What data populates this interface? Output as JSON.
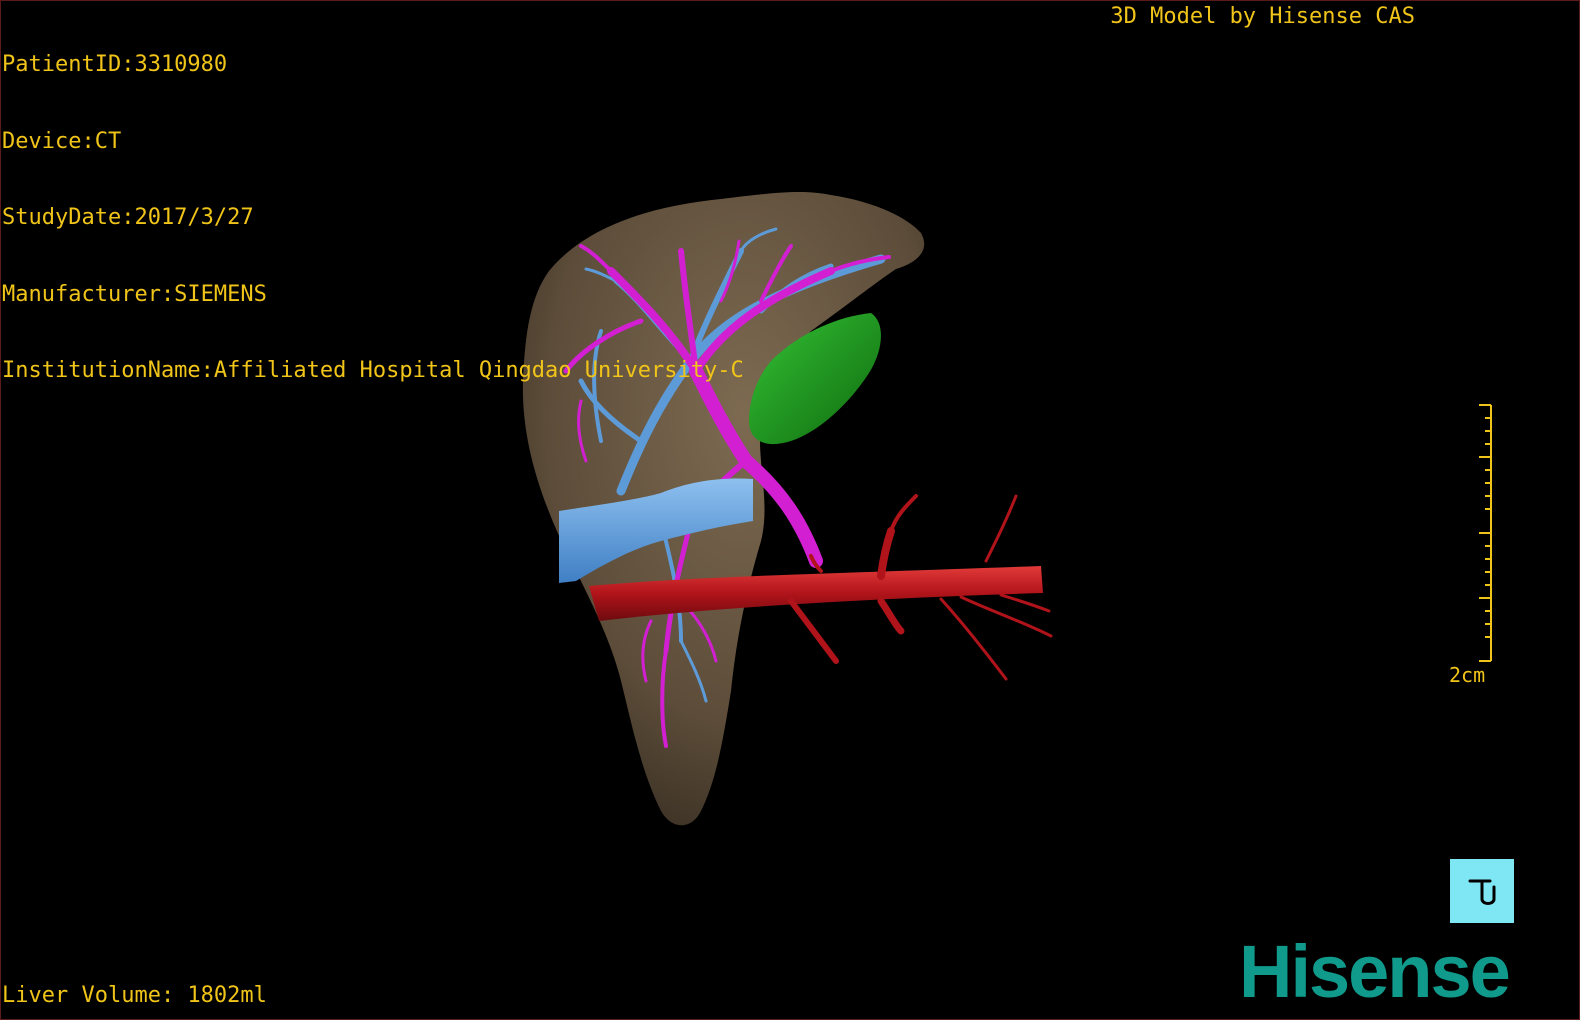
{
  "info": {
    "patient_id": "PatientID:3310980",
    "device": "Device:CT",
    "study_date": "StudyDate:2017/3/27",
    "manufacturer": "Manufacturer:SIEMENS",
    "institution": "InstitutionName:Affiliated Hospital Qingdao University-C"
  },
  "credit": "3D Model by Hisense CAS",
  "volume": "Liver Volume: 1802ml",
  "scale_label": "2cm",
  "brand": "Hisense",
  "orientation_icon": "posterior-view-icon",
  "colors": {
    "overlay_text": "#f0c419",
    "liver": "#6b5a44",
    "portal_vein": "#d21fd2",
    "hepatic_vein": "#5d9bd8",
    "gallbladder": "#1f8a1f",
    "vena_cava": "#5d9bd8",
    "aorta": "#b0141a",
    "brand": "#0f9a8c",
    "orientation_button": "#7fe6f4"
  }
}
